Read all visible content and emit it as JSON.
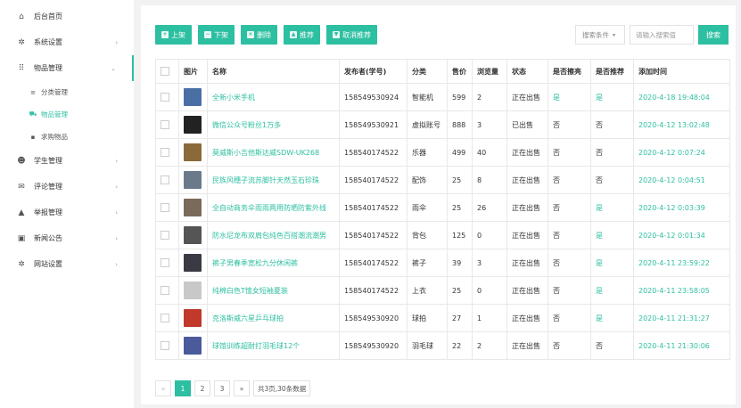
{
  "sidebar": {
    "items": [
      {
        "label": "后台首页",
        "icon": "home-icon",
        "glyph": "⌂",
        "arrow": ""
      },
      {
        "label": "系统设置",
        "icon": "gear-icon",
        "glyph": "✲",
        "arrow": "›"
      },
      {
        "label": "物品管理",
        "icon": "grid-icon",
        "glyph": "⠿",
        "arrow": "⌄"
      },
      {
        "label": "学生管理",
        "icon": "users-icon",
        "glyph": "☻",
        "arrow": "›"
      },
      {
        "label": "评论管理",
        "icon": "comment-icon",
        "glyph": "✉",
        "arrow": "›"
      },
      {
        "label": "举报管理",
        "icon": "warning-icon",
        "glyph": "▲",
        "arrow": "›"
      },
      {
        "label": "新闻公告",
        "icon": "news-icon",
        "glyph": "▣",
        "arrow": "›"
      },
      {
        "label": "网站设置",
        "icon": "gear-icon",
        "glyph": "✲",
        "arrow": "›"
      }
    ],
    "sub_items": [
      {
        "label": "分类管理",
        "icon": "list-icon",
        "glyph": "≡"
      },
      {
        "label": "物品管理",
        "icon": "cart-icon",
        "glyph": "⛟"
      },
      {
        "label": "求购物品",
        "icon": "box-icon",
        "glyph": "▪"
      }
    ]
  },
  "toolbar": {
    "buttons": [
      {
        "label": "上架",
        "icon": "plus-icon",
        "glyph": "+"
      },
      {
        "label": "下架",
        "icon": "minus-icon",
        "glyph": "−"
      },
      {
        "label": "删除",
        "icon": "delete-icon",
        "glyph": "×"
      },
      {
        "label": "推荐",
        "icon": "thumb-up-icon",
        "glyph": "▲"
      },
      {
        "label": "取消推荐",
        "icon": "thumb-down-icon",
        "glyph": "▼"
      }
    ]
  },
  "search": {
    "condition_label": "搜索条件",
    "caret": "▾",
    "placeholder": "请输入搜索值",
    "button_label": "搜索"
  },
  "table": {
    "columns": [
      "",
      "图片",
      "名称",
      "发布者(学号)",
      "分类",
      "售价",
      "浏览量",
      "状态",
      "是否擦亮",
      "是否推荐",
      "添加时间"
    ],
    "rows": [
      {
        "thumb": "#4a6fa5",
        "name": "全新小米手机",
        "publisher": "158549530924",
        "category": "智能机",
        "price": "599",
        "views": "2",
        "status": "正在出售",
        "polished": "是",
        "recommended": "是",
        "time": "2020-4-18 19:48:04"
      },
      {
        "thumb": "#222222",
        "name": "微信公众号粉丝1万多",
        "publisher": "158549530921",
        "category": "虚拟账号",
        "price": "888",
        "views": "3",
        "status": "已出售",
        "polished": "否",
        "recommended": "否",
        "time": "2020-4-12 13:02:48"
      },
      {
        "thumb": "#8a6a3a",
        "name": "莫威斯小吉他斯达威SDW-UK268",
        "publisher": "158540174522",
        "category": "乐器",
        "price": "499",
        "views": "40",
        "status": "正在出售",
        "polished": "否",
        "recommended": "否",
        "time": "2020-4-12 0:07:24"
      },
      {
        "thumb": "#6a7a8a",
        "name": "民族风穗子流苏脚针天然玉石珍珠",
        "publisher": "158540174522",
        "category": "配饰",
        "price": "25",
        "views": "8",
        "status": "正在出售",
        "polished": "否",
        "recommended": "否",
        "time": "2020-4-12 0:04:51"
      },
      {
        "thumb": "#7a6a5a",
        "name": "全自动商务伞雨雨两用防晒防紫外线",
        "publisher": "158540174522",
        "category": "雨伞",
        "price": "25",
        "views": "26",
        "status": "正在出售",
        "polished": "否",
        "recommended": "是",
        "time": "2020-4-12 0:03:39"
      },
      {
        "thumb": "#555555",
        "name": "防水尼龙布双肩包纯色百搭潮流潮男",
        "publisher": "158540174522",
        "category": "背包",
        "price": "125",
        "views": "0",
        "status": "正在出售",
        "polished": "否",
        "recommended": "是",
        "time": "2020-4-12 0:01:34"
      },
      {
        "thumb": "#3a3a44",
        "name": "裤子男春季宽松九分休闲裤",
        "publisher": "158540174522",
        "category": "裤子",
        "price": "39",
        "views": "3",
        "status": "正在出售",
        "polished": "否",
        "recommended": "是",
        "time": "2020-4-11 23:59:22"
      },
      {
        "thumb": "#c8c8c8",
        "name": "纯棉白色T恤女短袖夏装",
        "publisher": "158540174522",
        "category": "上衣",
        "price": "25",
        "views": "0",
        "status": "正在出售",
        "polished": "否",
        "recommended": "是",
        "time": "2020-4-11 23:58:05"
      },
      {
        "thumb": "#c0392b",
        "name": "克洛斯威六星乒乓球拍",
        "publisher": "158549530920",
        "category": "球拍",
        "price": "27",
        "views": "1",
        "status": "正在出售",
        "polished": "否",
        "recommended": "是",
        "time": "2020-4-11 21:31:27"
      },
      {
        "thumb": "#4a5a9a",
        "name": "球馆训练超耐打羽毛球12个",
        "publisher": "158549530920",
        "category": "羽毛球",
        "price": "22",
        "views": "2",
        "status": "正在出售",
        "polished": "否",
        "recommended": "否",
        "time": "2020-4-11 21:30:06"
      }
    ]
  },
  "pagination": {
    "prev": "«",
    "pages": [
      "1",
      "2",
      "3"
    ],
    "current": "1",
    "next": "»",
    "summary": "共3页,30条数据"
  },
  "colors": {
    "accent": "#2dbfa1"
  }
}
